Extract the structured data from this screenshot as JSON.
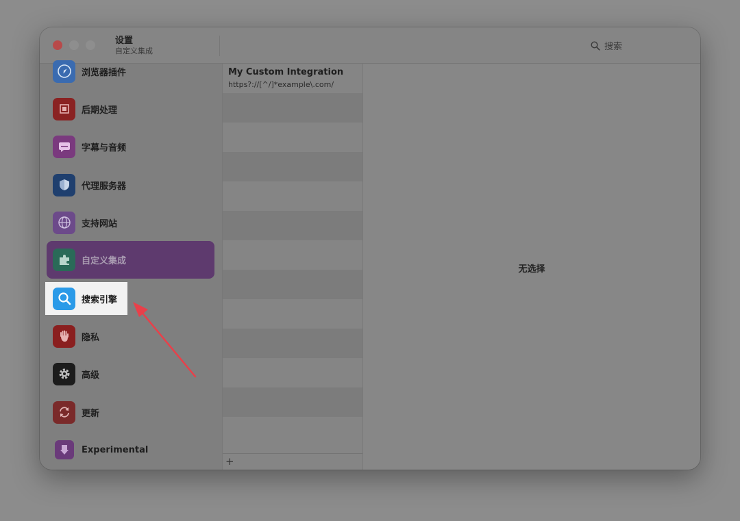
{
  "window": {
    "title": "设置",
    "subtitle": "自定义集成",
    "search_label": "搜索"
  },
  "sidebar": {
    "items": [
      {
        "label": "浏览器插件",
        "icon": "compass-icon",
        "color": "#3a6bb0"
      },
      {
        "label": "后期处理",
        "icon": "chip-icon",
        "color": "#8a2222"
      },
      {
        "label": "字幕与音频",
        "icon": "caption-icon",
        "color": "#7a3a7e"
      },
      {
        "label": "代理服务器",
        "icon": "shield-icon",
        "color": "#1f3f6e"
      },
      {
        "label": "支持网站",
        "icon": "globe-icon",
        "color": "#6c4a8a"
      },
      {
        "label": "自定义集成",
        "icon": "puzzle-icon",
        "color": "#2a6a58",
        "selected": true
      },
      {
        "label": "搜索引擎",
        "icon": "search-icon",
        "color": "#2a9ae8"
      },
      {
        "label": "隐私",
        "icon": "hand-icon",
        "color": "#8a1f1f"
      },
      {
        "label": "高级",
        "icon": "gear-icon",
        "color": "#1c1c1c"
      },
      {
        "label": "更新",
        "icon": "refresh-icon",
        "color": "#7a2a2a"
      },
      {
        "label": "Experimental",
        "icon": "flask-icon",
        "color": "#6a3a7a"
      }
    ]
  },
  "list": {
    "items": [
      {
        "title": "My Custom Integration",
        "subtitle": "https?://[^/]*example\\.com/"
      }
    ],
    "add_label": "+"
  },
  "detail": {
    "empty_label": "无选择"
  },
  "colors": {
    "selected_bg": "#5e3a6e",
    "highlight_bg": "#f2f2f2",
    "arrow": "#e8404a"
  }
}
